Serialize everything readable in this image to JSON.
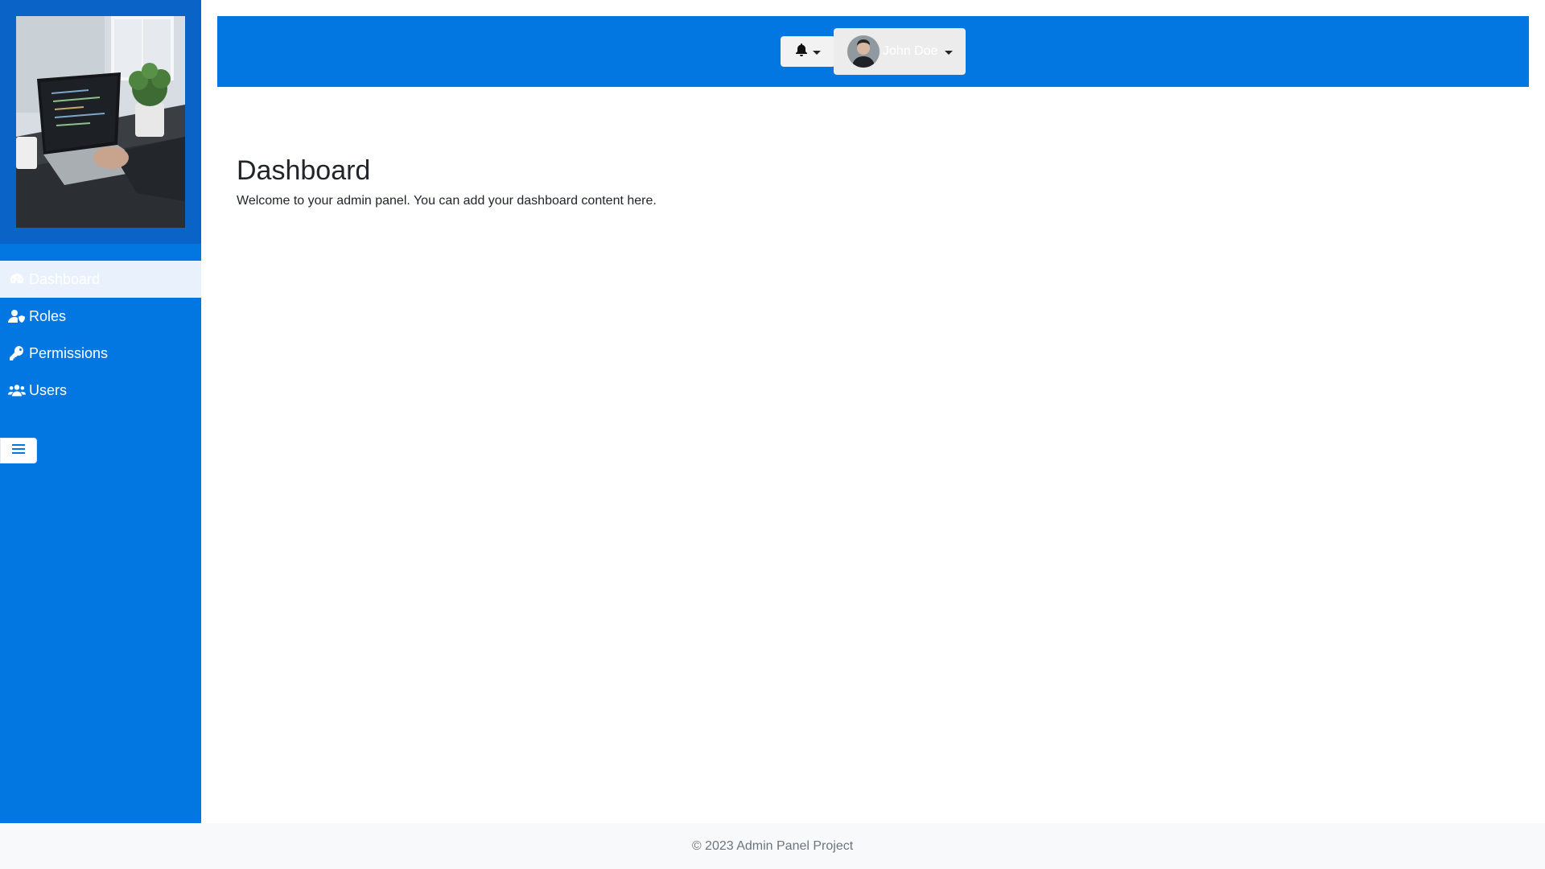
{
  "sidebar": {
    "photo_alt": "person typing on laptop",
    "items": [
      {
        "label": "Dashboard",
        "icon": "gauge-icon",
        "active": true
      },
      {
        "label": "Roles",
        "icon": "user-shield-icon",
        "active": false
      },
      {
        "label": "Permissions",
        "icon": "key-icon",
        "active": false
      },
      {
        "label": "Users",
        "icon": "users-icon",
        "active": false
      }
    ],
    "toggle_icon": "hamburger-icon"
  },
  "topbar": {
    "notifications_icon": "bell-icon",
    "user": {
      "name": "John Doe",
      "avatar_icon": "avatar"
    }
  },
  "main": {
    "title": "Dashboard",
    "welcome": "Welcome to your admin panel. You can add your dashboard content here."
  },
  "footer": {
    "text": "© 2023 Admin Panel Project"
  },
  "colors": {
    "primary": "#0277e1",
    "sidebar_header": "#0a64c8",
    "active_item_bg": "#e8f1fc",
    "footer_bg": "#f8f9fa"
  }
}
